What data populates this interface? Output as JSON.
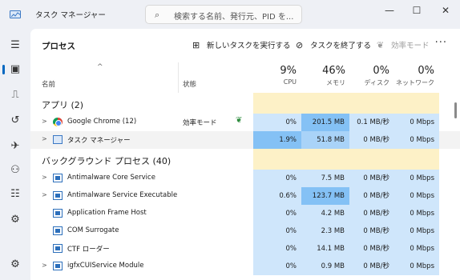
{
  "app": {
    "title": "タスク マネージャー"
  },
  "search": {
    "placeholder": "検索する名前、発行元、PID を..."
  },
  "window_controls": {
    "minimize": "—",
    "maximize": "☐",
    "close": "✕"
  },
  "sidebar": {
    "items": [
      {
        "name": "hamburger-menu",
        "icon": "menu-icon",
        "glyph": "☰"
      },
      {
        "name": "processes",
        "icon": "processes-icon",
        "glyph": "▣"
      },
      {
        "name": "performance",
        "icon": "performance-icon",
        "glyph": "⎍"
      },
      {
        "name": "app-history",
        "icon": "history-icon",
        "glyph": "↺"
      },
      {
        "name": "startup-apps",
        "icon": "startup-icon",
        "glyph": "✈"
      },
      {
        "name": "users",
        "icon": "users-icon",
        "glyph": "⚇"
      },
      {
        "name": "details",
        "icon": "details-icon",
        "glyph": "☷"
      },
      {
        "name": "services",
        "icon": "services-icon",
        "glyph": "⚙"
      },
      {
        "name": "settings",
        "icon": "settings-icon",
        "glyph": "⚙"
      }
    ]
  },
  "toolbar": {
    "title": "プロセス",
    "new_task": "新しいタスクを実行する",
    "end_task": "タスクを終了する",
    "efficiency": "効率モード",
    "more": "···"
  },
  "columns": {
    "sort_arrow": "^",
    "name": "名前",
    "status": "状態",
    "cpu": {
      "pct": "9%",
      "label": "CPU"
    },
    "memory": {
      "pct": "46%",
      "label": "メモリ"
    },
    "disk": {
      "pct": "0%",
      "label": "ディスク"
    },
    "network": {
      "pct": "0%",
      "label": "ネットワーク"
    }
  },
  "groups": {
    "apps": {
      "title": "アプリ (2)"
    },
    "background": {
      "title": "バックグラウンド プロセス (40)"
    }
  },
  "apps": [
    {
      "name": "Google Chrome (12)",
      "status": "効率モード",
      "cpu": "0%",
      "memory": "201.5 MB",
      "disk": "0.1 MB/秒",
      "network": "0 Mbps"
    },
    {
      "name": "タスク マネージャー",
      "status": "",
      "cpu": "1.9%",
      "memory": "51.8 MB",
      "disk": "0 MB/秒",
      "network": "0 Mbps"
    }
  ],
  "background": [
    {
      "name": "Antimalware Core Service",
      "cpu": "0%",
      "memory": "7.5 MB",
      "disk": "0 MB/秒",
      "network": "0 Mbps"
    },
    {
      "name": "Antimalware Service Executable",
      "cpu": "0.6%",
      "memory": "123.7 MB",
      "disk": "0 MB/秒",
      "network": "0 Mbps"
    },
    {
      "name": "Application Frame Host",
      "cpu": "0%",
      "memory": "4.2 MB",
      "disk": "0 MB/秒",
      "network": "0 Mbps"
    },
    {
      "name": "COM Surrogate",
      "cpu": "0%",
      "memory": "2.3 MB",
      "disk": "0 MB/秒",
      "network": "0 Mbps"
    },
    {
      "name": "CTF ローダー",
      "cpu": "0%",
      "memory": "14.1 MB",
      "disk": "0 MB/秒",
      "network": "0 Mbps"
    },
    {
      "name": "igfxCUIService Module",
      "cpu": "0%",
      "memory": "0.9 MB",
      "disk": "0 MB/秒",
      "network": "0 Mbps"
    }
  ],
  "colors": {
    "heat_light": "#fdf1c7",
    "heat_mid": "#cfe6fb",
    "heat_strong": "#a9d3f8",
    "heat_max": "#84c1f5",
    "accent": "#0067c0"
  }
}
